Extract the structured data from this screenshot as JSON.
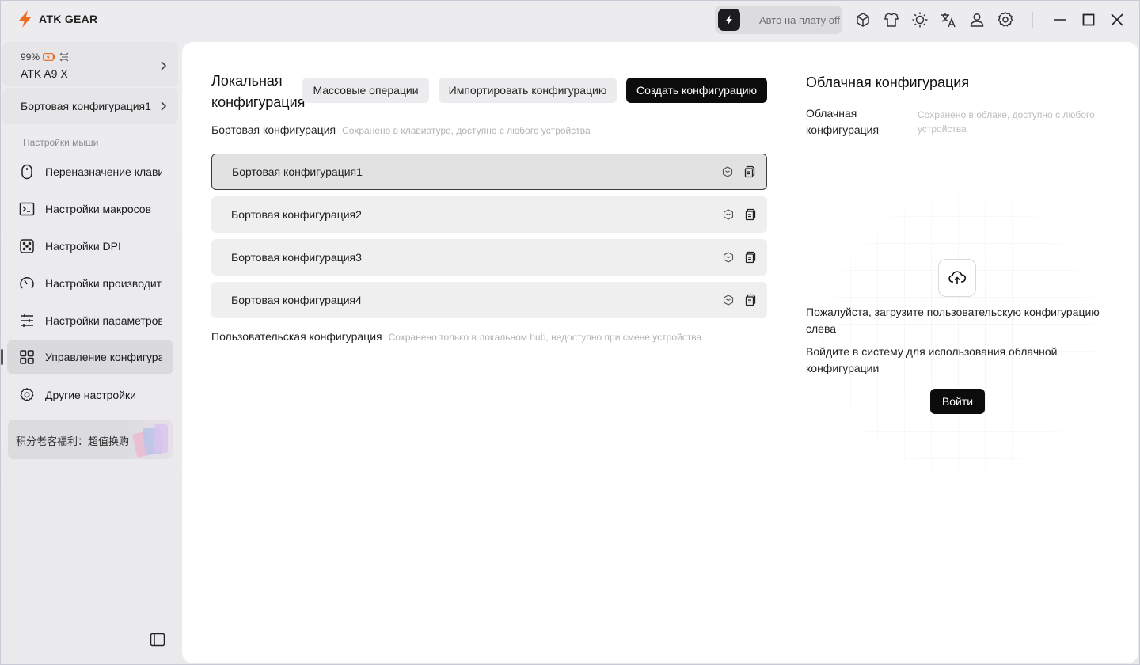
{
  "app": {
    "brand": "ATK GEAR",
    "accent_color": "#f26b1d"
  },
  "titlebar": {
    "auto_toggle_label": "Авто на плату off",
    "icons": [
      "lightning-icon",
      "cube-icon",
      "shirt-icon",
      "brightness-icon",
      "translate-icon",
      "user-icon",
      "settings-icon",
      "minimize-icon",
      "maximize-icon",
      "close-icon"
    ]
  },
  "sidebar": {
    "battery": "99%",
    "device_name": "ATK A9 X",
    "onboard_config": "Бортовая конфигурация1",
    "section_title": "Настройки мыши",
    "items": [
      {
        "label": "Переназначение клавиш",
        "icon": "mouse-icon"
      },
      {
        "label": "Настройки макросов",
        "icon": "terminal-icon"
      },
      {
        "label": "Настройки DPI",
        "icon": "dice-icon"
      },
      {
        "label": "Настройки производительности",
        "icon": "gauge-icon"
      },
      {
        "label": "Настройки параметров",
        "icon": "sliders-icon"
      },
      {
        "label": "Управление конфигурациями",
        "icon": "grid-icon"
      },
      {
        "label": "Другие настройки",
        "icon": "gear-icon"
      }
    ],
    "active_index": 5,
    "promo": "积分老客福利：超值换购"
  },
  "local": {
    "title": "Локальная конфигурация",
    "buttons": {
      "bulk": "Массовые операции",
      "import": "Импортировать конфигурацию",
      "create": "Создать конфигурацию"
    },
    "onboard_title": "Бортовая конфигурация",
    "onboard_hint": "Сохранено в клавиатуре, доступно с любого устройства",
    "configs": [
      {
        "name": "Бортовая конфигурация1",
        "selected": true
      },
      {
        "name": "Бортовая конфигурация2",
        "selected": false
      },
      {
        "name": "Бортовая конфигурация3",
        "selected": false
      },
      {
        "name": "Бортовая конфигурация4",
        "selected": false
      }
    ],
    "user_title": "Пользовательская конфигурация",
    "user_hint": "Сохранено только в локальном hub, недоступно при смене устройства"
  },
  "cloud": {
    "title": "Облачная конфигурация",
    "label": "Облачная конфигурация",
    "hint": "Сохранено в облаке, доступно с любого устройства",
    "upload_msg": "Пожалуйста, загрузите пользовательскую конфигурацию слева",
    "login_msg": "Войдите в систему для использования облачной конфигурации",
    "login_button": "Войти"
  }
}
